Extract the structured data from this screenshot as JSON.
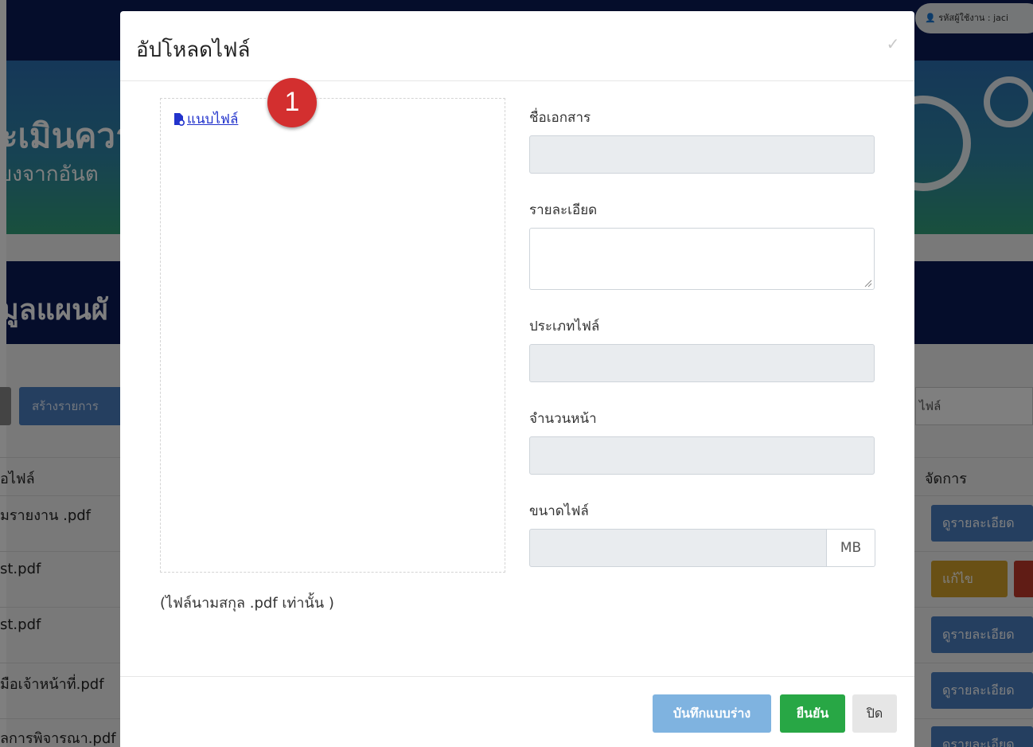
{
  "background": {
    "user_label": "รหัสผู้ใช้งาน : jaci",
    "hero_title": "ะเมินควา",
    "hero_subtitle": "ี่ยงจากอันต",
    "section_title": "มูลแผนผั",
    "create_button": "สร้างรายการ",
    "search_hint": "ไฟล์",
    "col_file": "อไฟล์",
    "col_manage": "จัดการ",
    "rows": [
      {
        "file": "มรายงาน .pdf",
        "action": "ดูรายละเอียด"
      },
      {
        "file": "st.pdf",
        "action": "แก้ไข"
      },
      {
        "file": "st.pdf",
        "action": "ดูรายละเอียด"
      },
      {
        "file": "มือเจ้าหน้าที่.pdf",
        "action": "ดูรายละเอียด"
      },
      {
        "file": "ลการพิจารณา.pdf",
        "action": "ดูรายละเอียด"
      }
    ]
  },
  "modal": {
    "title": "อัปโหลดไฟล์",
    "close_icon": "close-icon",
    "attach_label": "แนบไฟล์",
    "callout_number": "1",
    "hint": "(ไฟล์นามสกุล .pdf เท่านั้น )",
    "fields": {
      "doc_name_label": "ชื่อเอกสาร",
      "detail_label": "รายละเอียด",
      "file_type_label": "ประเภทไฟล์",
      "page_count_label": "จำนวนหน้า",
      "file_size_label": "ขนาดไฟล์",
      "file_size_unit": "MB"
    },
    "footer": {
      "draft_button": "บันทึกแบบร่าง",
      "confirm_button": "ยืนยัน",
      "close_button": "ปิด"
    }
  },
  "colors": {
    "navy": "#0b1b57",
    "primary": "#4a7fc1",
    "success": "#28a745",
    "callout": "#d32f2f"
  }
}
